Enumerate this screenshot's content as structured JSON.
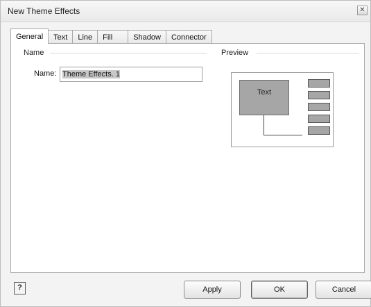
{
  "window": {
    "title": "New Theme Effects",
    "close_symbol": "✕"
  },
  "tabs": [
    {
      "label": "General",
      "active": true
    },
    {
      "label": "Text",
      "active": false
    },
    {
      "label": "Line",
      "active": false
    },
    {
      "label": "Fill",
      "active": false
    },
    {
      "label": "Shadow",
      "active": false
    },
    {
      "label": "Connector",
      "active": false
    }
  ],
  "general": {
    "name_group": "Name",
    "name_label": "Name:",
    "name_value": "Theme Effects. 1",
    "preview_group": "Preview",
    "preview_shape_text": "Text"
  },
  "footer": {
    "help_symbol": "?",
    "apply_label": "Apply",
    "ok_label": "OK",
    "cancel_label": "Cancel"
  }
}
